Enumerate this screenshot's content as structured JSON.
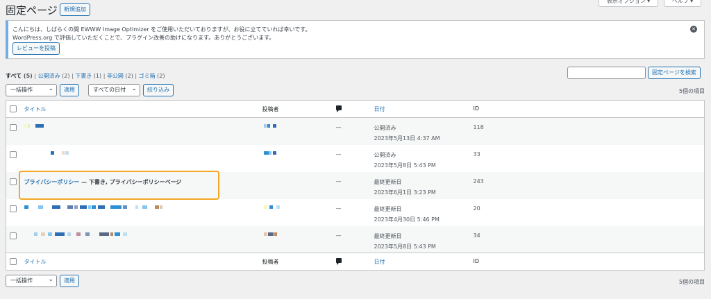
{
  "screen_options": {
    "label": "表示オプション ▾"
  },
  "help": {
    "label": "ヘルプ ▾"
  },
  "page_title": "固定ページ",
  "add_new_label": "新規追加",
  "notice": {
    "line1": "こんにちは、しばらくの間 EWWW Image Optimizer をご使用いただいておりますが、お役に立てていれば幸いです。",
    "line2": "WordPress.org で評価していただくことで、プラグイン改善の助けになります。ありがとうございます。",
    "review_label": "レビューを投稿",
    "dismiss": "✕"
  },
  "views": [
    {
      "label": "すべて",
      "count": "(5)"
    },
    {
      "label": "公開済み",
      "count": "(2)"
    },
    {
      "label": "下書き",
      "count": "(1)"
    },
    {
      "label": "非公開",
      "count": "(2)"
    },
    {
      "label": "ゴミ箱",
      "count": "(2)"
    }
  ],
  "search": {
    "button_label": "固定ページを検索"
  },
  "bulk_action": {
    "selected": "一括操作",
    "apply_label": "適用"
  },
  "date_filter": {
    "selected": "すべての日付",
    "filter_label": "絞り込み"
  },
  "items_count": "5個の項目",
  "columns": {
    "title": "タイトル",
    "author": "投稿者",
    "date": "日付",
    "id": "ID"
  },
  "rows": [
    {
      "status": "公開済み",
      "date": "2023年5月13日 4:37 AM",
      "id": "118"
    },
    {
      "status": "公開済み",
      "date": "2023年5月8日 5:43 PM",
      "id": "33"
    },
    {
      "title": "プライバシーポリシー",
      "state": " — 下書き, プライバシーポリシーページ",
      "status": "最終更新日",
      "date": "2023年6月1日 3:23 PM",
      "id": "243"
    },
    {
      "status": "最終更新日",
      "date": "2023年4月30日 5:46 PM",
      "id": "20"
    },
    {
      "status": "最終更新日",
      "date": "2023年5月8日 5:43 PM",
      "id": "34"
    }
  ],
  "comment_dash": "—",
  "colors": {
    "link": "#2271b1",
    "highlight": "#f5a623",
    "notice_border": "#72aee6"
  },
  "icons": {
    "comments": "comment-bubble-icon",
    "dismiss": "dismiss-icon"
  }
}
